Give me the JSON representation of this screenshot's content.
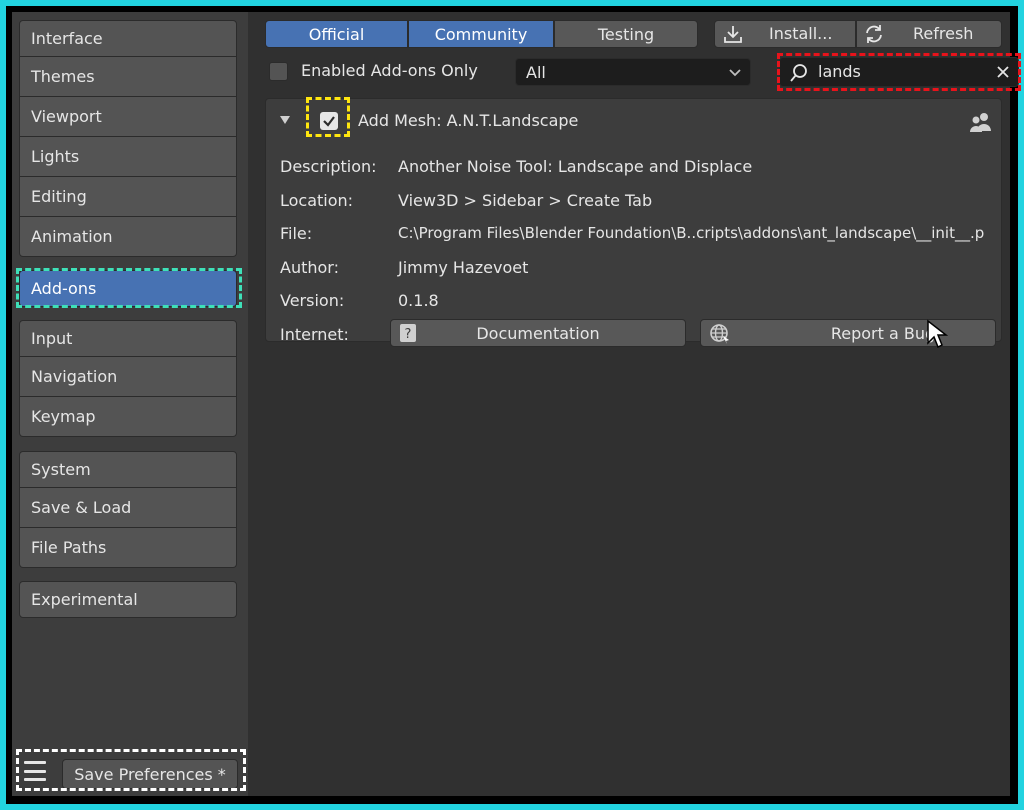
{
  "sidebar": {
    "groups": [
      [
        "Interface",
        "Themes",
        "Viewport",
        "Lights",
        "Editing",
        "Animation"
      ],
      [
        "Add-ons"
      ],
      [
        "Input",
        "Navigation",
        "Keymap"
      ],
      [
        "System",
        "Save & Load",
        "File Paths"
      ],
      [
        "Experimental"
      ]
    ],
    "active": "Add-ons",
    "save_label": "Save Preferences *"
  },
  "tabs": [
    {
      "label": "Official",
      "active": true
    },
    {
      "label": "Community",
      "active": true
    },
    {
      "label": "Testing",
      "active": false
    }
  ],
  "actions": {
    "install": "Install...",
    "refresh": "Refresh"
  },
  "filter": {
    "enabled_only_label": "Enabled Add-ons Only",
    "category": "All",
    "search_value": "lands"
  },
  "addon": {
    "title": "Add Mesh: A.N.T.Landscape",
    "enabled": true,
    "fields": [
      {
        "label": "Description:",
        "value": "Another Noise Tool: Landscape and Displace"
      },
      {
        "label": "Location:",
        "value": "View3D > Sidebar > Create Tab"
      },
      {
        "label": "File:",
        "value": "C:\\Program Files\\Blender Foundation\\B..cripts\\addons\\ant_landscape\\__init__.p"
      },
      {
        "label": "Author:",
        "value": "Jimmy Hazevoet"
      },
      {
        "label": "Version:",
        "value": "0.1.8"
      }
    ],
    "internet_label": "Internet:",
    "documentation_label": "Documentation",
    "report_bug_label": "Report a Bug"
  },
  "colors": {
    "accent": "#4772b3",
    "highlight_green": "#3ee0b8",
    "highlight_red": "#e8131b",
    "highlight_yellow": "#ffe60f",
    "frame": "#22d3e0"
  }
}
